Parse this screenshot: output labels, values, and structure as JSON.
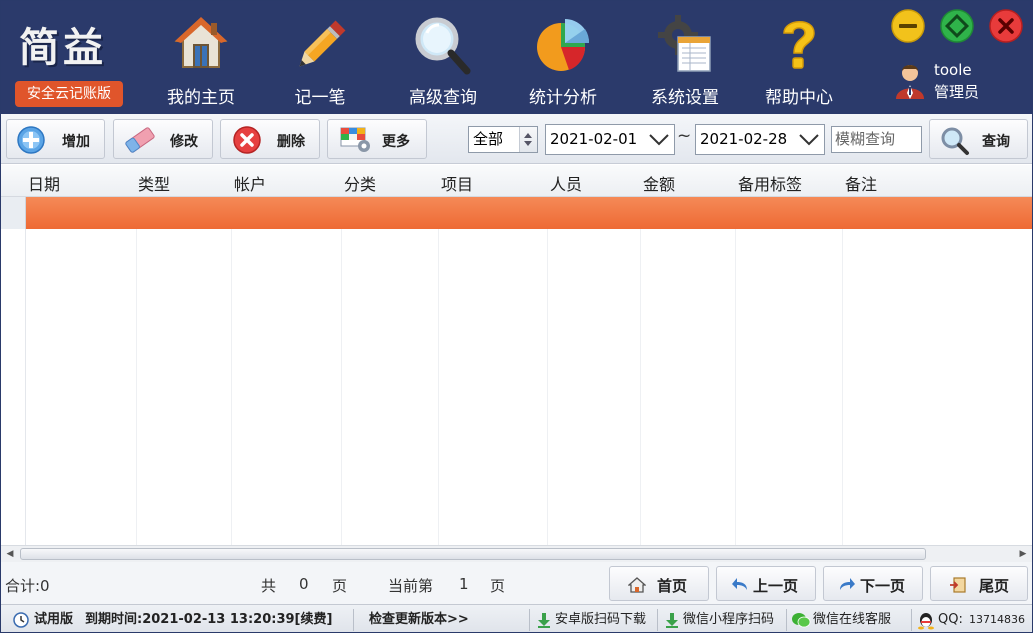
{
  "app": {
    "logo_title": "简益",
    "logo_subtitle": "安全云记账版"
  },
  "nav": [
    {
      "label": "我的主页",
      "icon": "home-icon"
    },
    {
      "label": "记一笔",
      "icon": "pencil-icon"
    },
    {
      "label": "高级查询",
      "icon": "magnifier-icon"
    },
    {
      "label": "统计分析",
      "icon": "pie-chart-icon"
    },
    {
      "label": "系统设置",
      "icon": "settings-icon"
    },
    {
      "label": "帮助中心",
      "icon": "help-icon"
    }
  ],
  "user": {
    "name": "toole",
    "role": "管理员"
  },
  "window_controls": {
    "minimize": "minimize-icon",
    "maximize": "maximize-icon",
    "close": "close-icon",
    "colors": {
      "minimize": "#f2c21b",
      "maximize": "#2fb34a",
      "close": "#e83b3b"
    }
  },
  "toolbar": {
    "add": "增加",
    "edit": "修改",
    "delete": "删除",
    "more": "更多",
    "type_select": "全部",
    "date_from": "2021-02-01",
    "date_sep": "~",
    "date_to": "2021-02-28",
    "fuzzy_placeholder": "模糊查询",
    "search": "查询"
  },
  "table": {
    "columns": [
      "日期",
      "类型",
      "帐户",
      "分类",
      "项目",
      "人员",
      "金额",
      "备用标签",
      "备注"
    ],
    "rows": [],
    "selected_row_color": "#ef6f3a"
  },
  "pager": {
    "total_label": "合计:0",
    "total_pages_prefix": "共",
    "total_pages": "0",
    "total_pages_suffix": "页",
    "current_prefix": "当前第",
    "current_page": "1",
    "current_suffix": "页",
    "first": "首页",
    "prev": "上一页",
    "next": "下一页",
    "last": "尾页"
  },
  "status": {
    "edition": "试用版",
    "expire": "到期时间:2021-02-13 13:20:39[续费]",
    "update": "检查更新版本>>",
    "android": "安卓版扫码下载",
    "miniapp": "微信小程序扫码",
    "wechat_service": "微信在线客服",
    "qq_label": "QQ:",
    "qq_number": "13714836"
  }
}
